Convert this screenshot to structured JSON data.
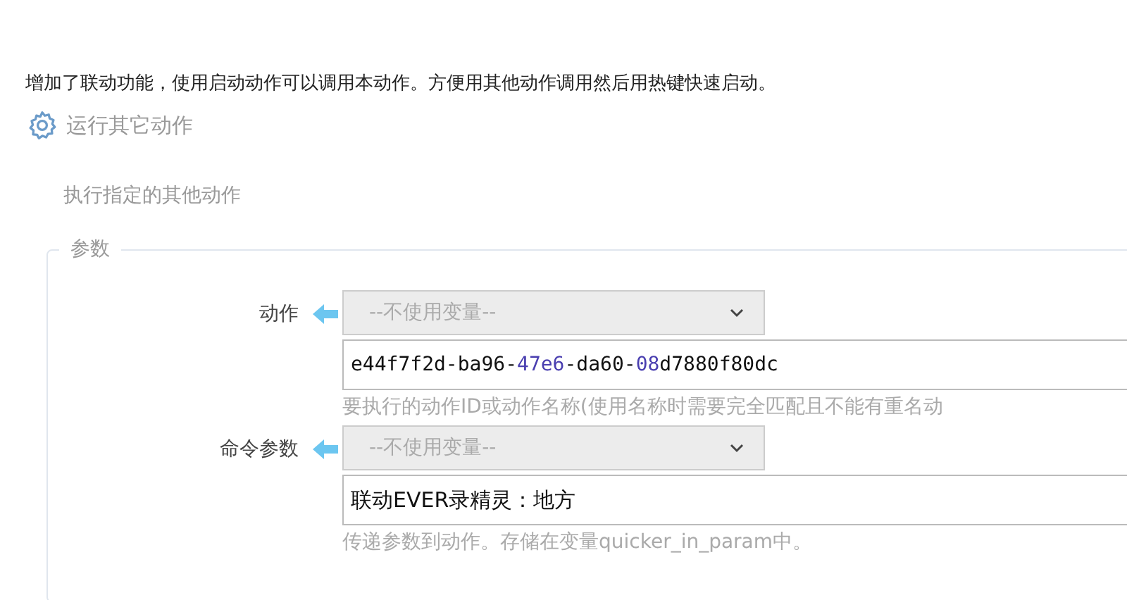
{
  "description": "增加了联动功能，使用启动动作可以调用本动作。方便用其他动作调用然后用热键快速启动。",
  "step": {
    "title": "运行其它动作",
    "subtitle": "执行指定的其他动作"
  },
  "params": {
    "legend": "参数",
    "fields": [
      {
        "label": "动作",
        "variable": "--不使用变量--",
        "value": [
          {
            "text": "e44f7f2d-ba96-",
            "highlight": false
          },
          {
            "text": "47e6",
            "highlight": true
          },
          {
            "text": "-da60-",
            "highlight": false
          },
          {
            "text": "08",
            "highlight": true
          },
          {
            "text": "d7880f80dc",
            "highlight": false
          }
        ],
        "help": "要执行的动作ID或动作名称(使用名称时需要完全匹配且不能有重名动"
      },
      {
        "label": "命令参数",
        "variable": "--不使用变量--",
        "value": [
          {
            "text": "联动EVER录精灵：地方",
            "highlight": false
          }
        ],
        "help": "传递参数到动作。存储在变量quicker_in_param中。"
      }
    ]
  }
}
